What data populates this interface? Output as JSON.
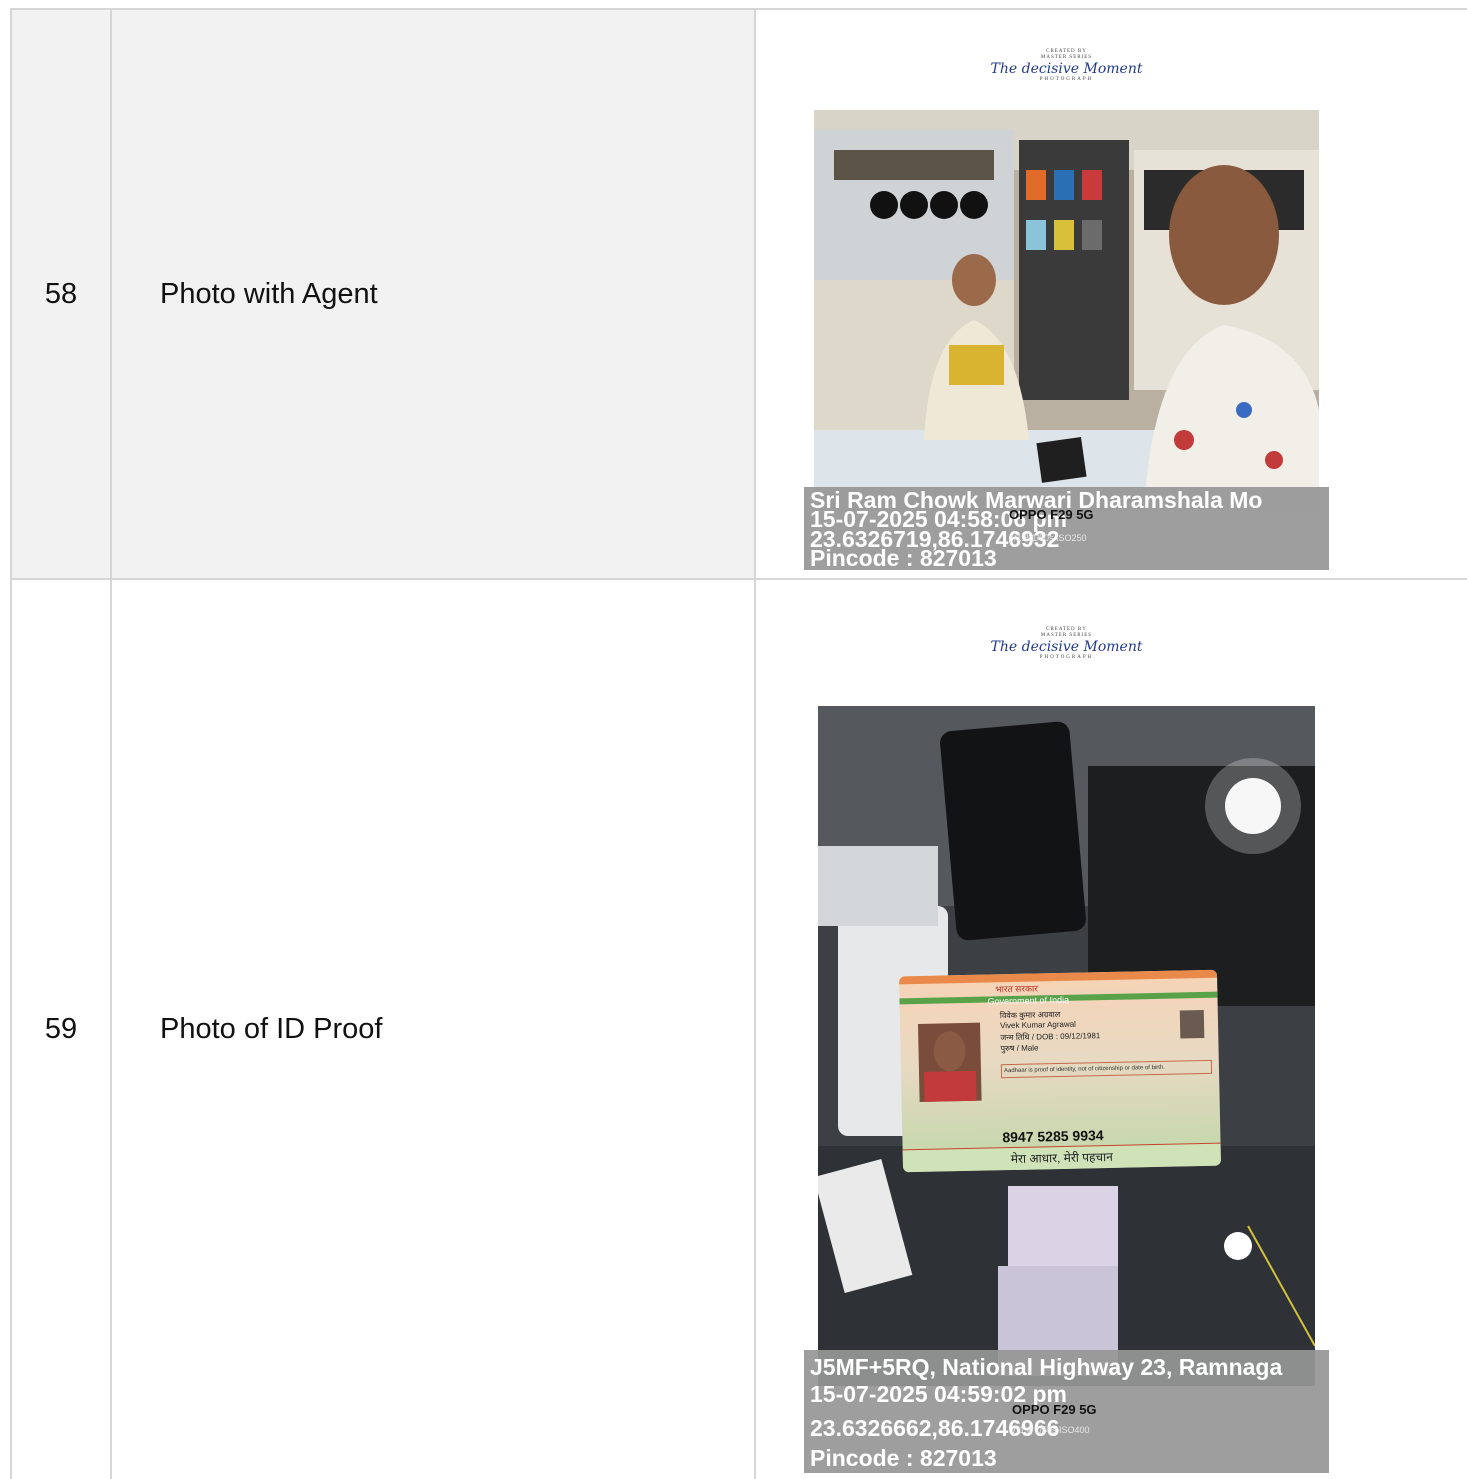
{
  "rows": [
    {
      "number": "58",
      "label": "Photo with Agent",
      "photo": {
        "brand_top": "CREATED BY\nMASTER SERIES",
        "brand_script": "The decisive Moment",
        "brand_bottom": "PHOTOGRAPH",
        "overlay_lines": [
          "Sri Ram Chowk Marwari Dharamshala Mo",
          "15-07-2025 04:58:06 pm",
          "23.6326719,86.1746932",
          "Pincode : 827013"
        ],
        "device": "OPPO F29 5G",
        "device_sub": "ƒ/1.8 1/50s ISO250"
      }
    },
    {
      "number": "59",
      "label": "Photo of ID Proof",
      "photo": {
        "brand_top": "CREATED BY\nMASTER SERIES",
        "brand_script": "The decisive Moment",
        "brand_bottom": "PHOTOGRAPH",
        "card": {
          "line_gov_hi": "भारत सरकार",
          "line_gov_en": "Government of India",
          "name_hi": "विवेक कुमार अग्रवाल",
          "name_en": "Vivek Kumar Agrawal",
          "dob": "जन्म तिथि / DOB : 09/12/1981",
          "gender": "पुरुष / Male",
          "note_en": "Aadhaar is proof of identity, not of citizenship or date of birth.",
          "number": "8947 5285 9934",
          "tagline": "मेरा आधार, मेरी पहचान"
        },
        "overlay_lines": [
          "J5MF+5RQ, National Highway 23, Ramnaga",
          "15-07-2025 04:59:02 pm",
          "23.6326662,86.1746966",
          "Pincode : 827013"
        ],
        "device": "OPPO F29 5G",
        "device_sub": "ƒ/1.8 1/50s ISO400"
      }
    }
  ]
}
